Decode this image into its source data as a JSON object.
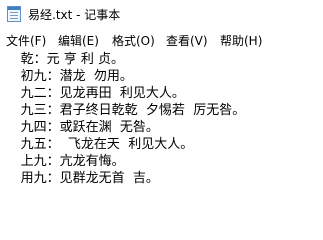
{
  "window": {
    "title": "易经.txt - 记事本",
    "icon": "notepad-icon"
  },
  "menu": {
    "items": [
      {
        "label": "文件(F)"
      },
      {
        "label": "编辑(E)"
      },
      {
        "label": "格式(O)"
      },
      {
        "label": "查看(V)"
      },
      {
        "label": "帮助(H)"
      }
    ]
  },
  "document": {
    "lines": [
      "     乾：元 亨 利 贞。",
      "     初九：潜龙  勿用。",
      "     九二：见龙再田  利见大人。",
      "     九三：君子终日乾乾  夕惕若  厉无咎。",
      "     九四：或跃在渊  无咎。",
      "     九五：  飞龙在天  利见大人。",
      "     上九：亢龙有悔。",
      "     用九：见群龙无首  吉。"
    ]
  }
}
